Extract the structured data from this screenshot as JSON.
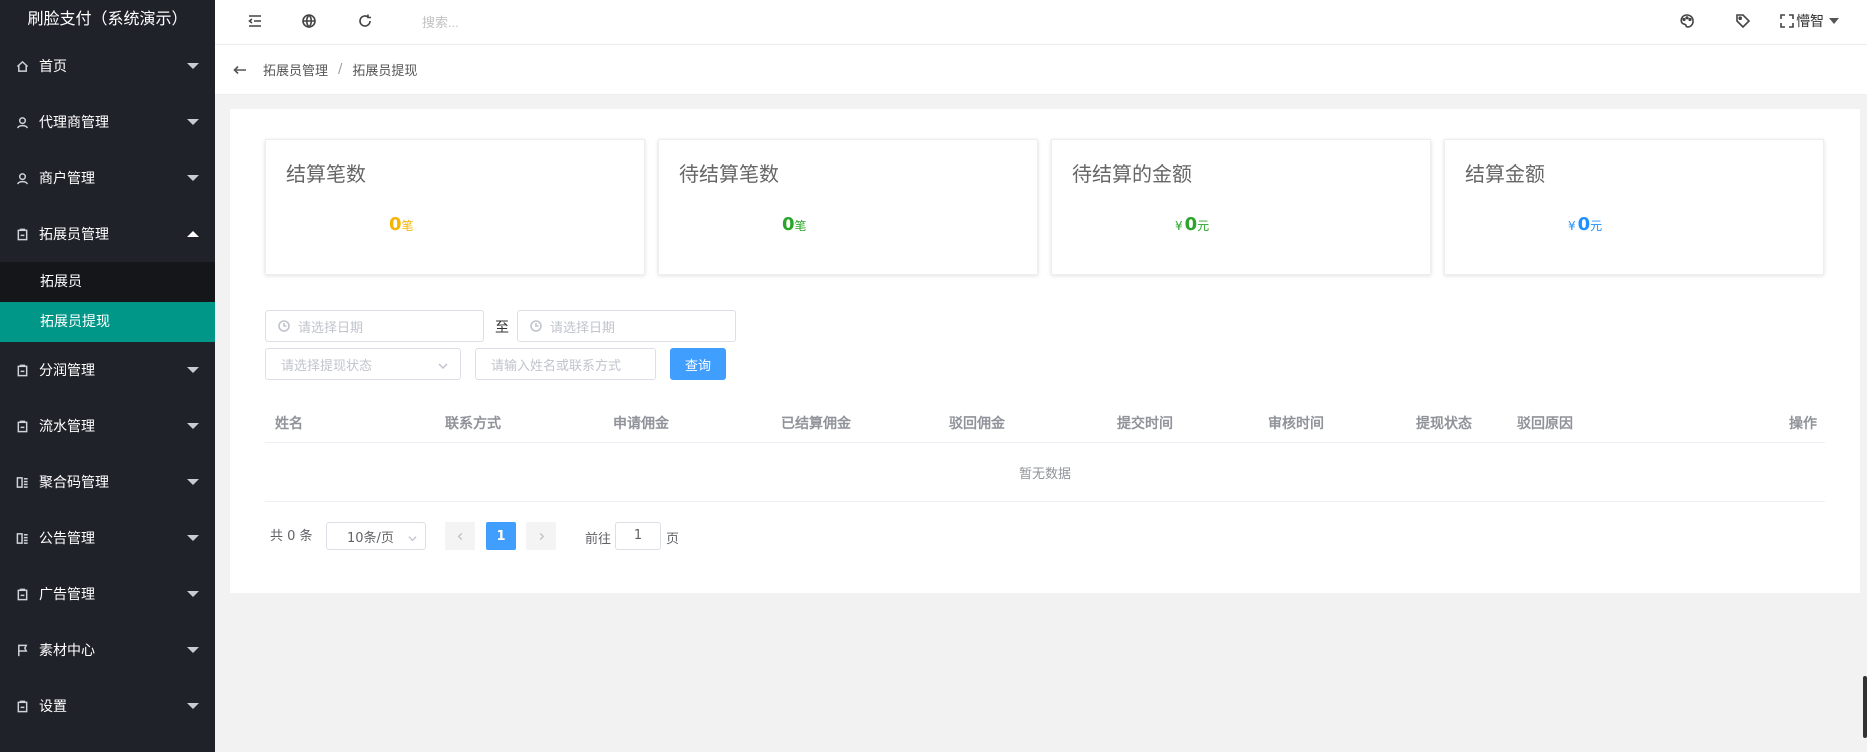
{
  "app": {
    "title": "刷脸支付（系统演示）"
  },
  "sidebar": {
    "items": [
      {
        "label": "首页",
        "icon": "home-icon"
      },
      {
        "label": "代理商管理",
        "icon": "user-icon"
      },
      {
        "label": "商户管理",
        "icon": "user-icon"
      },
      {
        "label": "拓展员管理",
        "icon": "clipboard-icon",
        "expanded": true,
        "children": [
          {
            "label": "拓展员"
          },
          {
            "label": "拓展员提现",
            "active": true
          }
        ]
      },
      {
        "label": "分润管理",
        "icon": "clipboard-icon"
      },
      {
        "label": "流水管理",
        "icon": "clipboard-icon"
      },
      {
        "label": "聚合码管理",
        "icon": "list-icon"
      },
      {
        "label": "公告管理",
        "icon": "list-icon"
      },
      {
        "label": "广告管理",
        "icon": "clipboard-icon"
      },
      {
        "label": "素材中心",
        "icon": "flag-icon"
      },
      {
        "label": "设置",
        "icon": "clipboard-icon"
      }
    ]
  },
  "topbar": {
    "search_placeholder": "搜索...",
    "user_name": "懵智",
    "icons": [
      "menu-toggle-icon",
      "globe-icon",
      "refresh-icon",
      "palette-icon",
      "tag-icon",
      "fullscreen-icon"
    ]
  },
  "breadcrumb": {
    "parent": "拓展员管理",
    "separator": "/",
    "current": "拓展员提现"
  },
  "stats": [
    {
      "title": "结算笔数",
      "currency": "",
      "value": "0",
      "unit": "笔",
      "color": "#f4b400"
    },
    {
      "title": "待结算笔数",
      "currency": "",
      "value": "0",
      "unit": "笔",
      "color": "#2aa52a"
    },
    {
      "title": "待结算的金额",
      "currency": "¥",
      "value": "0",
      "unit": "元",
      "color": "#2aa52a"
    },
    {
      "title": "结算金额",
      "currency": "¥",
      "value": "0",
      "unit": "元",
      "color": "#1e90ff"
    }
  ],
  "filters": {
    "start_date_placeholder": "请选择日期",
    "to_label": "至",
    "end_date_placeholder": "请选择日期",
    "status_placeholder": "请选择提现状态",
    "keyword_placeholder": "请输入姓名或联系方式",
    "query_button": "查询"
  },
  "table": {
    "columns": [
      "姓名",
      "联系方式",
      "申请佣金",
      "已结算佣金",
      "驳回佣金",
      "提交时间",
      "审核时间",
      "提现状态",
      "驳回原因",
      "操作"
    ],
    "empty_text": "暂无数据"
  },
  "pagination": {
    "total_text": "共 0 条",
    "page_size": "10条/页",
    "current_page": "1",
    "goto_label": "前往",
    "goto_value": "1",
    "page_label": "页"
  }
}
